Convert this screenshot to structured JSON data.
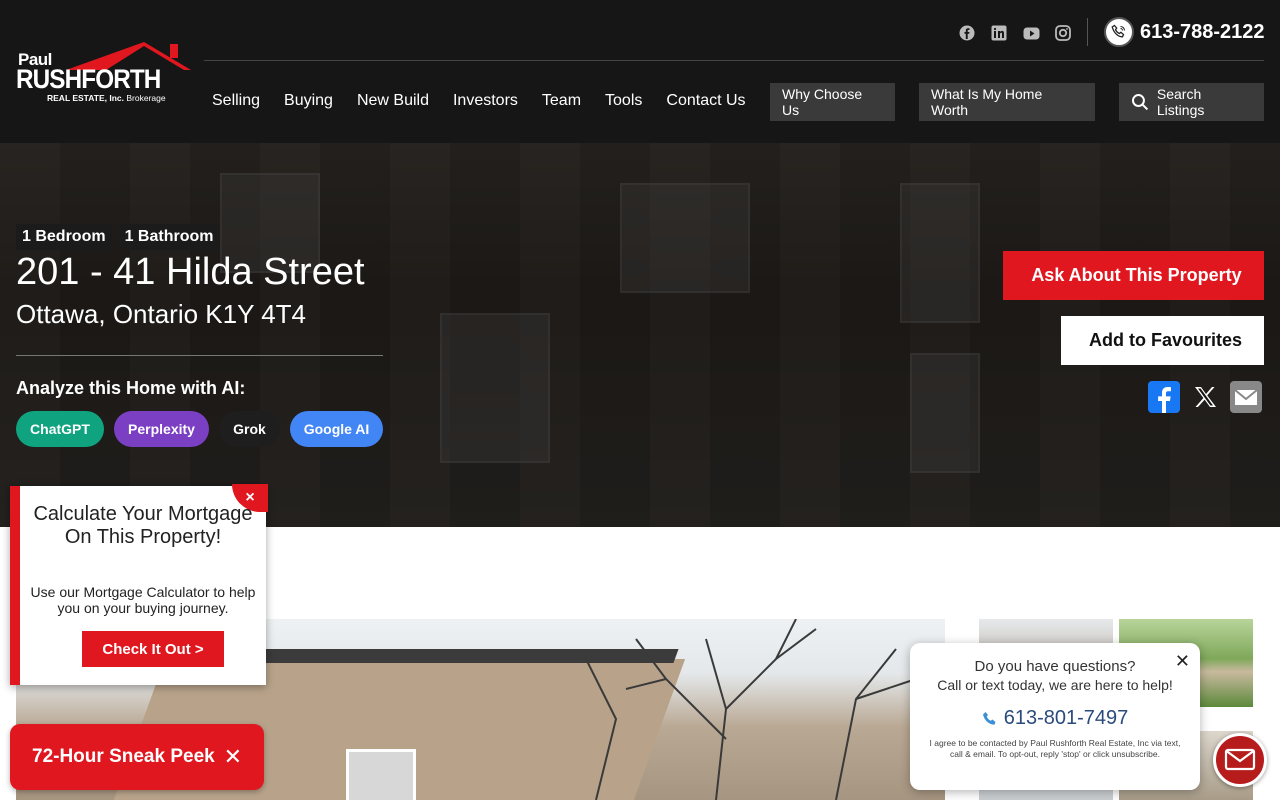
{
  "brand": {
    "line1": "Paul",
    "line2": "RUSHFORTH",
    "line3_bold": "REAL ESTATE, Inc.",
    "line3_light": "Brokerage",
    "accent_color": "#e0171e"
  },
  "header": {
    "social_icons": [
      "facebook-icon",
      "linkedin-icon",
      "youtube-icon",
      "instagram-icon"
    ],
    "phone": "613-788-2122",
    "nav": [
      "Selling",
      "Buying",
      "New Build",
      "Investors",
      "Team",
      "Tools",
      "Contact Us"
    ],
    "why_label": "Why Choose Us",
    "worth_label": "What Is My Home Worth",
    "search_label": "Search Listings"
  },
  "listing": {
    "bedrooms": "1 Bedroom",
    "bathrooms": "1 Bathroom",
    "street": "201 - 41 Hilda Street",
    "city": "Ottawa, Ontario K1Y 4T4",
    "ai_label": "Analyze this Home with AI:",
    "ai_buttons": [
      {
        "label": "ChatGPT",
        "color": "#10a37f"
      },
      {
        "label": "Perplexity",
        "color": "#7b3fc4"
      },
      {
        "label": "Grok",
        "color": "#1e1e1e"
      },
      {
        "label": "Google AI",
        "color": "#4285f4"
      }
    ],
    "ask_label": "Ask About This Property",
    "ask_glyph": "",
    "fav_label": "Add to Favourites",
    "fav_glyph": "",
    "share_icons": [
      "facebook-share-icon",
      "x-share-icon",
      "email-share-icon"
    ]
  },
  "mortgage_popup": {
    "title": "Calculate Your Mortgage On This Property!",
    "desc": "Use our Mortgage Calculator to help you on your buying journey.",
    "cta": "Check It Out >",
    "close": "×"
  },
  "sneak_peek": {
    "label": "72-Hour Sneak Peek",
    "close": "✕"
  },
  "chat_popup": {
    "q1": "Do you have questions?",
    "q2": "Call or text today, we are here to help!",
    "phone": "613-801-7497",
    "legal": "I agree to be contacted by Paul Rushforth Real Estate, Inc via text, call & email. To opt-out, reply 'stop' or click unsubscribe.",
    "close": "✕"
  }
}
